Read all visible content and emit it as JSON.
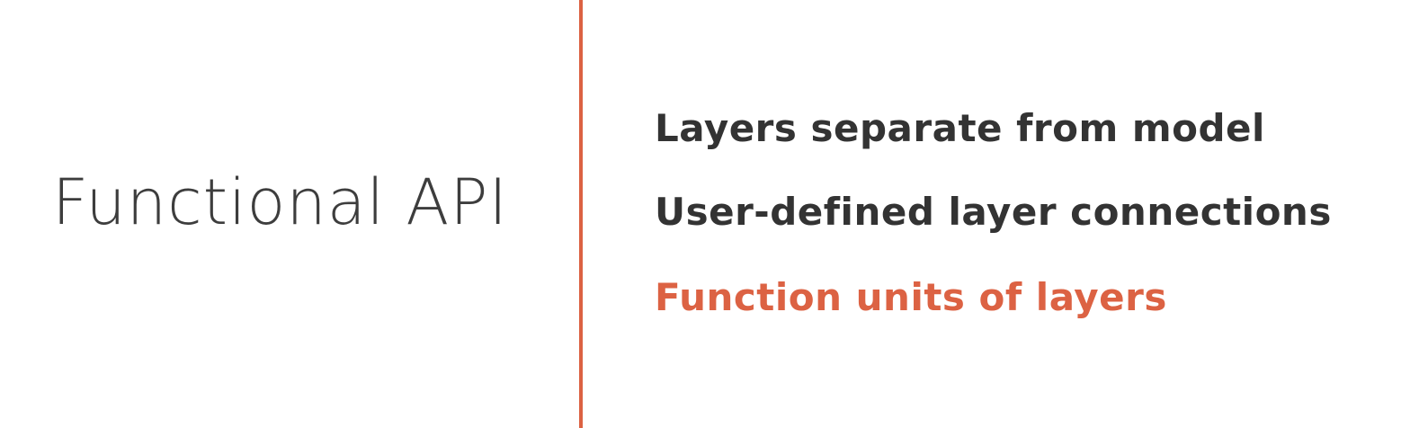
{
  "slide": {
    "title": "Functional API",
    "bullets": [
      "Layers separate from model",
      "User-defined layer connections",
      "Function units of layers"
    ],
    "active_bullet_index": 2
  },
  "colors": {
    "background": "#ffffff",
    "title_text": "#3d3d3d",
    "bullet_text": "#333333",
    "accent": "#dc6243",
    "divider": "#dc6243"
  }
}
